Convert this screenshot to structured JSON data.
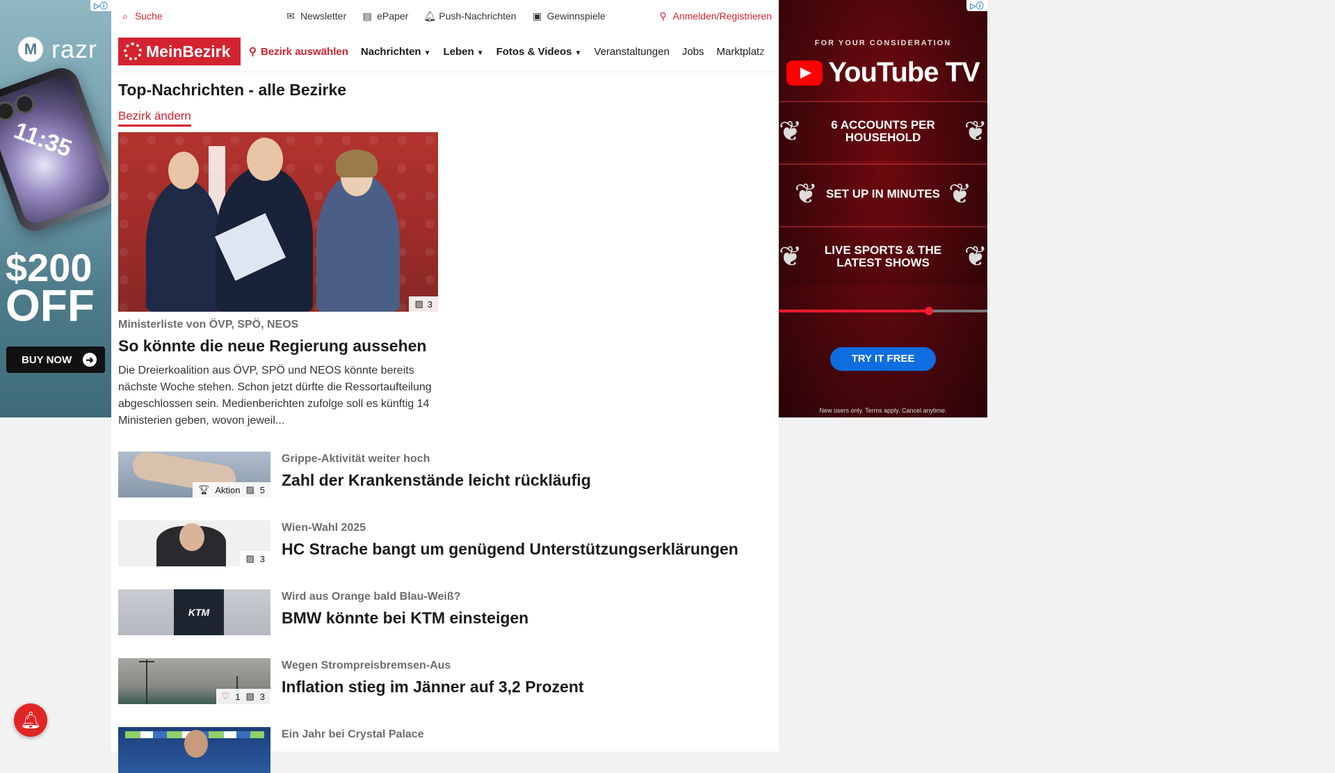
{
  "ad_left": {
    "brand": "razr",
    "phone_time": "11:35",
    "price": "$200",
    "off": "OFF",
    "cta": "BUY NOW"
  },
  "header": {
    "search": "Suche",
    "newsletter": "Newsletter",
    "epaper": "ePaper",
    "push": "Push-Nachrichten",
    "gewinnspiele": "Gewinnspiele",
    "login": "Anmelden/Registrieren"
  },
  "nav": {
    "logo": "MeinBezirk",
    "bezirk": "Bezirk auswählen",
    "items": [
      "Nachrichten",
      "Leben",
      "Fotos & Videos",
      "Veranstaltungen",
      "Jobs",
      "Marktplatz"
    ]
  },
  "main": {
    "title": "Top-Nachrichten - alle Bezirke",
    "change_link": "Bezirk ändern",
    "hero": {
      "image_count": "3",
      "kicker": "Ministerliste von ÖVP, SPÖ, NEOS",
      "headline": "So könnte die neue Regierung aussehen",
      "teaser": "Die Dreierkoalition aus ÖVP, SPÖ und NEOS könnte bereits nächste Woche stehen. Schon jetzt dürfte die Ressortaufteilung abgeschlossen sein. Medienberichten zufolge soll es künftig 14 Ministerien geben, wovon jeweil..."
    },
    "articles": [
      {
        "kicker": "Grippe-Aktivität weiter hoch",
        "headline": "Zahl der Krankenstände leicht rückläufig",
        "badge_label": "Aktion",
        "image_count": "5"
      },
      {
        "kicker": "Wien-Wahl 2025",
        "headline": "HC Strache bangt um genügend Unterstützungserklärungen",
        "image_count": "3"
      },
      {
        "kicker": "Wird aus Orange bald Blau-Weiß?",
        "headline": "BMW könnte bei KTM einsteigen",
        "thumb_text": "KTM"
      },
      {
        "kicker": "Wegen Strompreisbremsen-Aus",
        "headline": "Inflation stieg im Jänner auf 3,2 Prozent",
        "likes": "1",
        "image_count": "3"
      },
      {
        "kicker": "Ein Jahr bei Crystal Palace",
        "headline": ""
      }
    ]
  },
  "ad_right": {
    "eyebrow": "FOR YOUR CONSIDERATION",
    "brand": "YouTube TV",
    "points": [
      "6 ACCOUNTS PER HOUSEHOLD",
      "SET UP IN MINUTES",
      "LIVE SPORTS & THE LATEST SHOWS"
    ],
    "progress": 0.72,
    "cta": "TRY IT FREE",
    "fineprint": "New users only. Terms apply. Cancel anytime."
  }
}
